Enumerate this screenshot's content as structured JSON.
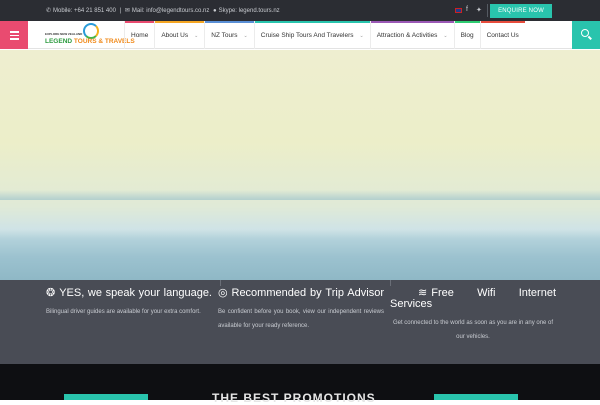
{
  "topbar": {
    "mobile": "Mobile: +64 21 851 400",
    "mail": "Mail: info@legendtours.co.nz",
    "skype": "Skype: legend.tours.nz",
    "enquire_label": "ENQUIRE NOW"
  },
  "logo": {
    "tagline": "EXPLORE NEW ZEALAND",
    "brand_first": "LEGEND ",
    "brand_second": "TOURS & TRAVELS"
  },
  "nav": {
    "items": [
      {
        "label": "Home"
      },
      {
        "label": "About Us"
      },
      {
        "label": "NZ Tours"
      },
      {
        "label": "Cruise Ship Tours And Travelers"
      },
      {
        "label": "Attraction & Activities"
      },
      {
        "label": "Blog"
      },
      {
        "label": "Contact Us"
      }
    ],
    "accent_colors": [
      "#e94b70",
      "#f5a623",
      "#5a8fd6",
      "#29c4ad",
      "#9b59b6",
      "#2ecc71",
      "#e74c3c"
    ]
  },
  "features": [
    {
      "icon": "globe-icon",
      "title": "YES, we speak your language.",
      "desc": "Bilingual driver guides are available for your extra comfort."
    },
    {
      "icon": "tripadvisor-icon",
      "title": "Recommended by Trip Advisor",
      "desc": "Be confident before you book, view our independent reviews available for your ready reference."
    },
    {
      "icon": "wifi-icon",
      "title": "Free Wifi Internet Services",
      "desc": "Get connected to the world as soon as you are in any one of our vehicles."
    }
  ],
  "promotions": {
    "title": "THE BEST PROMOTIONS"
  },
  "colors": {
    "accent_teal": "#29c4ad",
    "accent_pink": "#e94b70",
    "topbar_bg": "#2b2d33",
    "features_bg": "#494c55"
  }
}
